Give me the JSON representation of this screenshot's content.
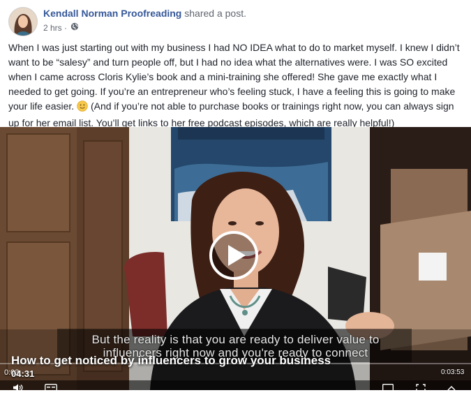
{
  "post": {
    "author": "Kendall Norman Proofreading",
    "action": "shared a post.",
    "time": "2 hrs",
    "separator": "·",
    "text_before_emoji": "When I was just starting out with my business I had NO IDEA what to do to market myself. I knew I didn’t want to be “salesy” and turn people off, but I had no idea what the alternatives were. I was SO excited when I came across Cloris Kylie’s book and a mini-training she offered! She gave me exactly what I needed to get going. If you’re an entrepreneur who’s feeling stuck, I have a feeling this is going to make your life easier.",
    "text_after_emoji": "(And if you’re not able to purchase books or trainings right now, you can always sign up for her email list. You’ll get links to her free podcast episodes, which are really helpful!)"
  },
  "video": {
    "subtitle_line1": "But the reality is that you are ready to deliver value to",
    "subtitle_line2": "influencers right now and you're ready to connect",
    "title": "How to get noticed by influencers to grow your business",
    "duration": "04:31",
    "current_time": "0:03",
    "remaining_time": "0:03:53"
  },
  "colors": {
    "author": "#365899",
    "meta": "#606770",
    "text": "#1d2129"
  },
  "icons": {
    "privacy": "globe-icon",
    "emoji": "slightly-smiling-face-icon",
    "play": "play-icon"
  }
}
